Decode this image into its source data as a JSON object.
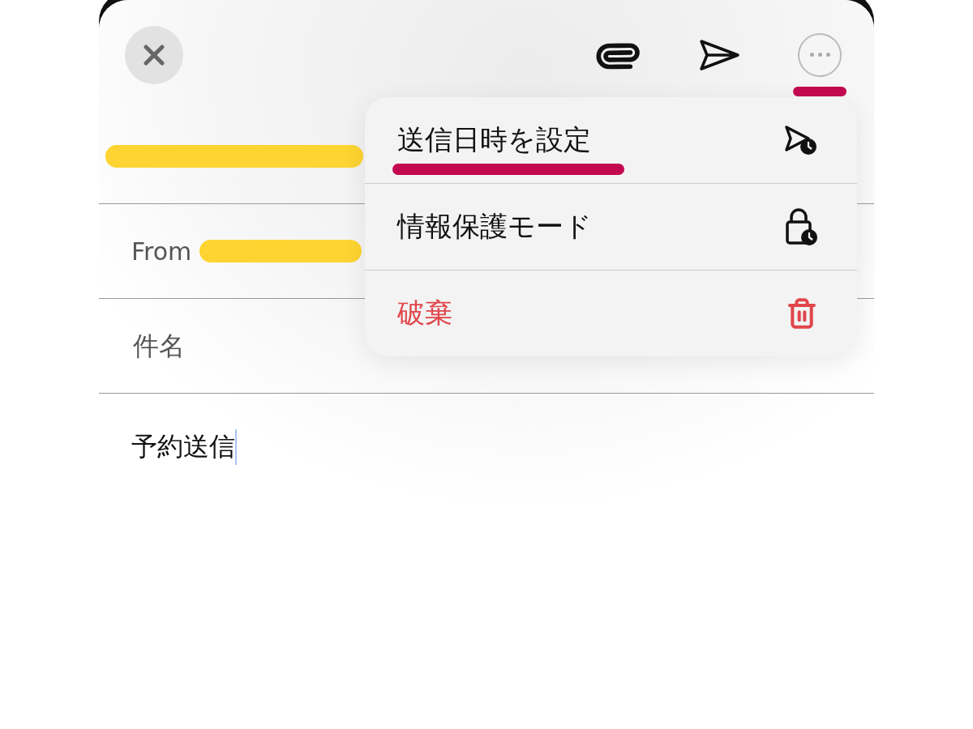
{
  "toolbar": {
    "more_button": {
      "marked": true
    }
  },
  "fields": [
    {
      "kind": "recipient",
      "redacted": true
    },
    {
      "kind": "sender",
      "label": "From",
      "redacted": true
    },
    {
      "kind": "subject",
      "placeholder": "件名"
    }
  ],
  "body": {
    "value": "予約送信"
  },
  "menu": {
    "items": [
      {
        "label": "送信日時を設定",
        "kind": "schedule",
        "marked": true
      },
      {
        "label": "情報保護モード",
        "kind": "confidential",
        "marked": false
      },
      {
        "label": "破棄",
        "kind": "discard",
        "marked": false
      }
    ]
  }
}
